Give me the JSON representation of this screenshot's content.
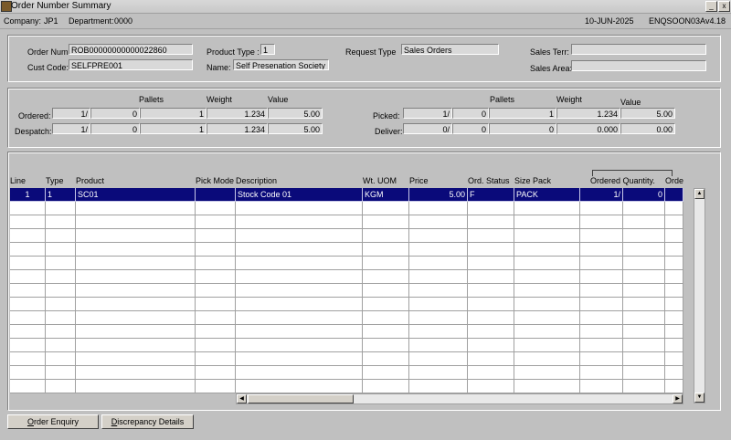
{
  "window": {
    "title": "Order Number Summary",
    "min_label": "_",
    "close_label": "x"
  },
  "info": {
    "company_label": "Company:",
    "company": "JP1",
    "department_label": "Department:",
    "department": "0000",
    "date": "10-JUN-2025",
    "screen_code": "ENQSOON03A",
    "version": "v4.18"
  },
  "order": {
    "order_num_label": "Order Num:",
    "order_num": "ROB00000000000022860",
    "cust_code_label": "Cust Code:",
    "cust_code": "SELFPRE001",
    "product_type_label": "Product Type :",
    "product_type": "1",
    "name_label": "Name:",
    "name": "Self Presenation Society",
    "request_type_label": "Request Type",
    "request_type": "Sales Orders",
    "sales_terr_label": "Sales Terr:",
    "sales_terr": "",
    "sales_area_label": "Sales Area:",
    "sales_area": ""
  },
  "totals": {
    "pallets_label": "Pallets",
    "weight_label": "Weight",
    "value_label": "Value",
    "rows_left": [
      {
        "label": "Ordered:",
        "a": "1/",
        "b": "0",
        "c": "1",
        "d": "1.234",
        "e": "5.00"
      },
      {
        "label": "Despatch:",
        "a": "1/",
        "b": "0",
        "c": "1",
        "d": "1.234",
        "e": "5.00"
      }
    ],
    "rows_right": [
      {
        "label": "Picked:",
        "a": "1/",
        "b": "0",
        "c": "1",
        "d": "1.234",
        "e": "5.00"
      },
      {
        "label": "Deliver:",
        "a": "0/",
        "b": "0",
        "c": "0",
        "d": "0.000",
        "e": "0.00"
      }
    ]
  },
  "table": {
    "columns": [
      "Line",
      "Type",
      "Product",
      "Pick Mode",
      "Description",
      "Wt. UOM",
      "Price",
      "Ord. Status",
      "Size Pack",
      "Ordered Quantity.",
      "Order"
    ],
    "rows": [
      [
        "1",
        "1",
        "SC01",
        "",
        "Stock Code 01",
        "KGM",
        "5.00",
        "F",
        "PACK",
        "1/",
        "0",
        ""
      ]
    ],
    "empty_rows": 14
  },
  "buttons": {
    "order_enquiry_u": "O",
    "order_enquiry_rest": "rder Enquiry",
    "discrepancy_u": "D",
    "discrepancy_rest": "iscrepancy Details"
  }
}
